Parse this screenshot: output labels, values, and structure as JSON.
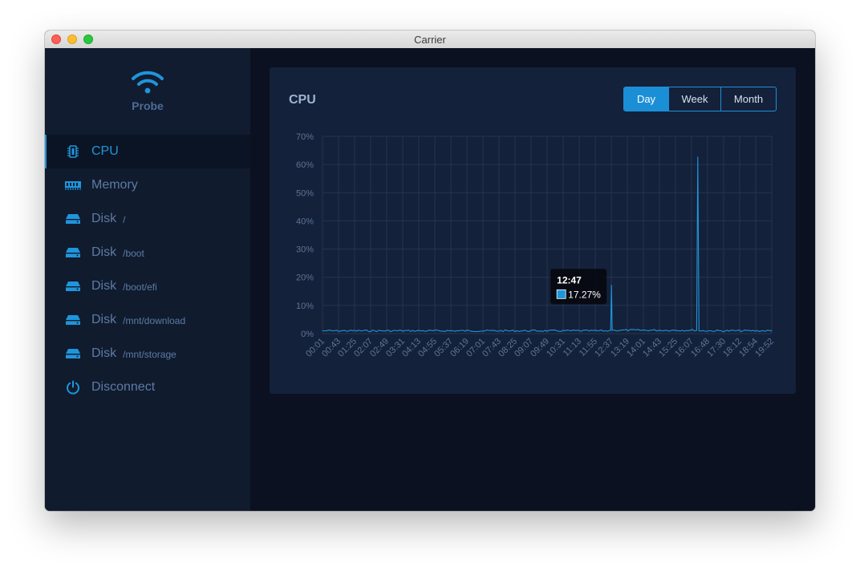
{
  "window": {
    "title": "Carrier"
  },
  "brand": {
    "name": "Probe"
  },
  "sidebar": {
    "items": [
      {
        "label": "CPU",
        "sub": "",
        "icon": "cpu-icon",
        "active": true
      },
      {
        "label": "Memory",
        "sub": "",
        "icon": "memory-icon",
        "active": false
      },
      {
        "label": "Disk",
        "sub": "/",
        "icon": "disk-icon",
        "active": false
      },
      {
        "label": "Disk",
        "sub": "/boot",
        "icon": "disk-icon",
        "active": false
      },
      {
        "label": "Disk",
        "sub": "/boot/efi",
        "icon": "disk-icon",
        "active": false
      },
      {
        "label": "Disk",
        "sub": "/mnt/download",
        "icon": "disk-icon",
        "active": false
      },
      {
        "label": "Disk",
        "sub": "/mnt/storage",
        "icon": "disk-icon",
        "active": false
      },
      {
        "label": "Disconnect",
        "sub": "",
        "icon": "power-icon",
        "active": false
      }
    ]
  },
  "card": {
    "title": "CPU"
  },
  "range": {
    "options": [
      "Day",
      "Week",
      "Month"
    ],
    "selected": "Day"
  },
  "colors": {
    "accent": "#1f95db",
    "sidebar": "#101b2e",
    "background": "#0b1120",
    "card": "#14213a"
  },
  "chart_data": {
    "type": "line",
    "title": "",
    "ylim": [
      0,
      70
    ],
    "y_ticks": [
      "0%",
      "10%",
      "20%",
      "30%",
      "40%",
      "50%",
      "60%",
      "70%"
    ],
    "x_tick_labels": [
      "00:01",
      "00:43",
      "01:25",
      "02:07",
      "02:49",
      "03:31",
      "04:13",
      "04:55",
      "05:37",
      "06:19",
      "07:01",
      "07:43",
      "08:25",
      "09:07",
      "09:49",
      "10:31",
      "11:13",
      "11:55",
      "12:37",
      "13:19",
      "14:01",
      "14:43",
      "15:25",
      "16:07",
      "16:48",
      "17:30",
      "18:12",
      "18:54",
      "19:52"
    ],
    "x_range": [
      "00:01",
      "19:52"
    ],
    "grid": true,
    "series": [
      {
        "unit": "%",
        "baseline": 1.0,
        "points": [
          {
            "x": "00:01",
            "y": 1.0
          },
          {
            "x": "12:40",
            "y": 1.0
          },
          {
            "x": "12:45",
            "y": 1.2
          },
          {
            "x": "12:47",
            "y": 17.27
          },
          {
            "x": "12:49",
            "y": 1.2
          },
          {
            "x": "16:33",
            "y": 1.0
          },
          {
            "x": "16:36",
            "y": 62.8
          },
          {
            "x": "16:39",
            "y": 1.0
          },
          {
            "x": "19:52",
            "y": 0.8
          }
        ]
      }
    ],
    "tooltip": {
      "time": "12:47",
      "value": "17.27%",
      "y": 17.27
    }
  }
}
